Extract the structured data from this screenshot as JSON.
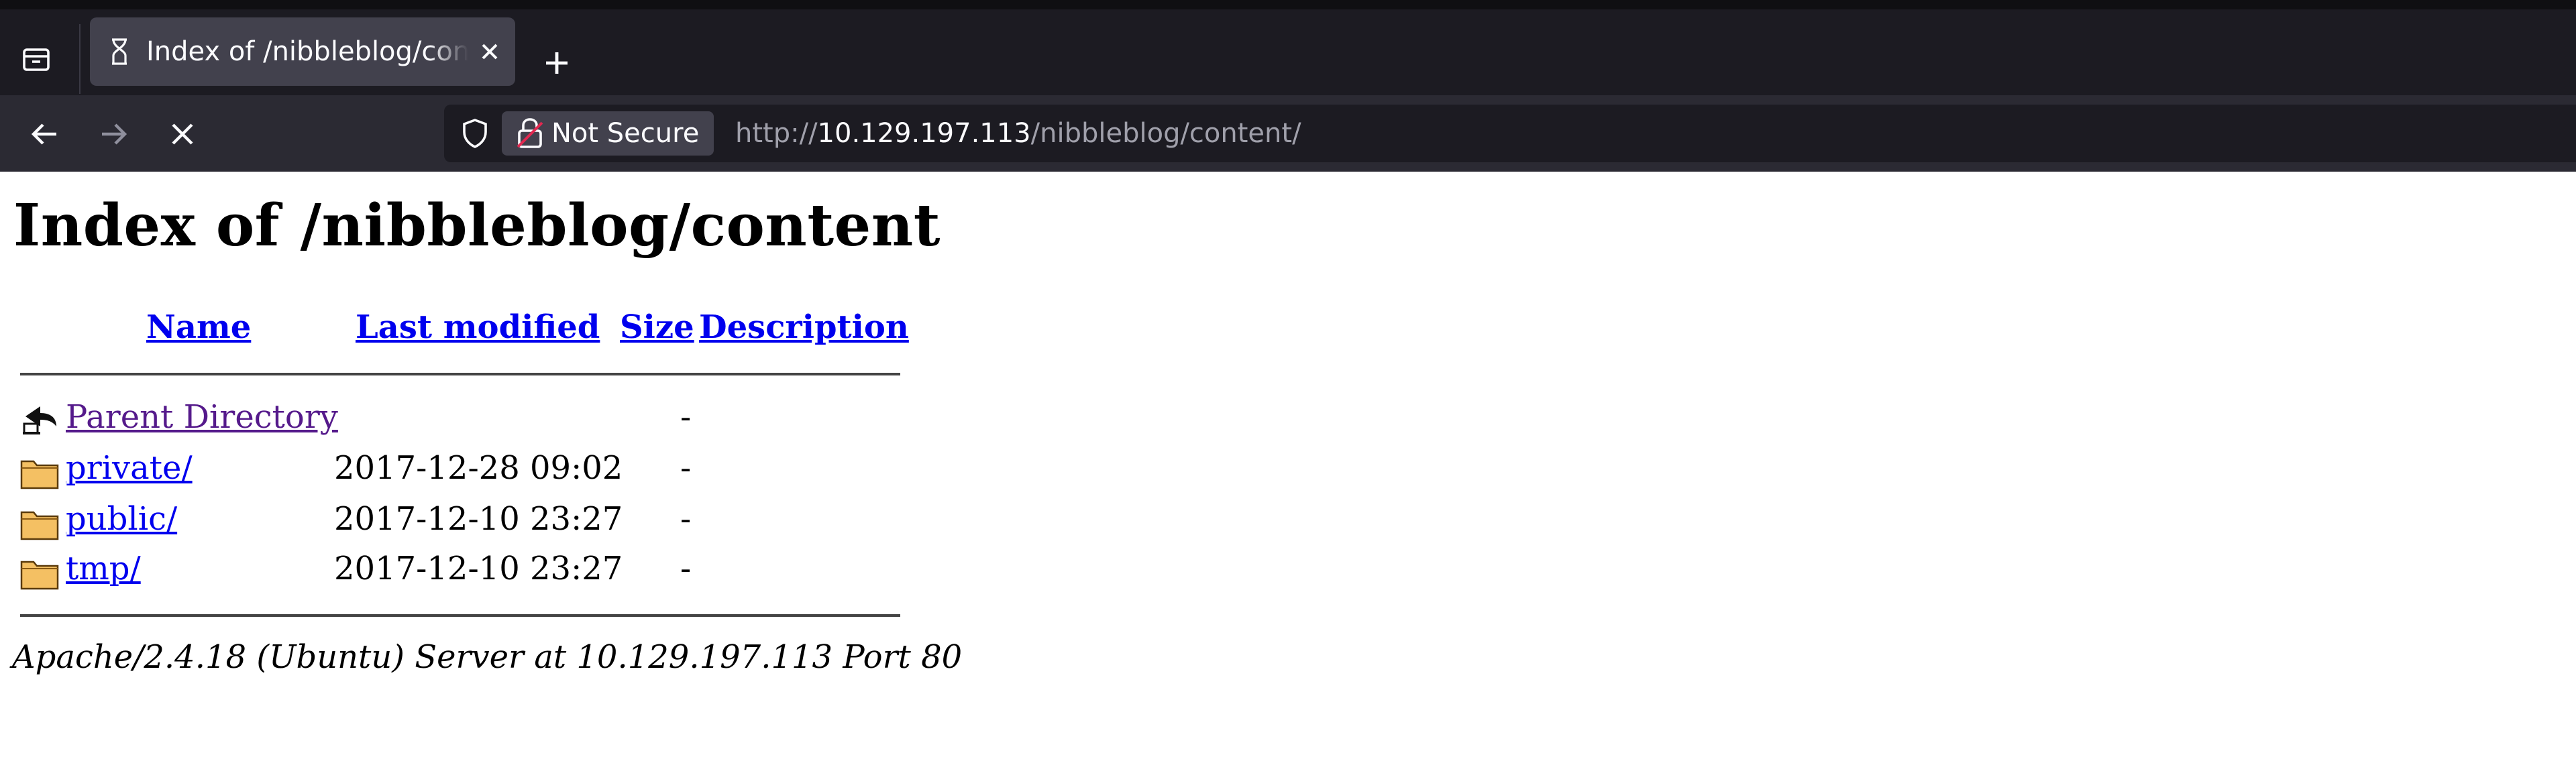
{
  "browser": {
    "tab": {
      "title": "Index of /nibbleblog/content/"
    },
    "url": {
      "scheme": "http://",
      "host": "10.129.197.113",
      "path": "/nibbleblog/content/"
    },
    "security_label": "Not Secure"
  },
  "page": {
    "heading": "Index of /nibbleblog/content",
    "columns": {
      "name": "Name",
      "last_modified": "Last modified",
      "size": "Size",
      "description": "Description"
    },
    "rows": [
      {
        "name": "Parent Directory",
        "modified": "",
        "size": "-",
        "icon": "back-arrow-icon"
      },
      {
        "name": "private/",
        "modified": "2017-12-28 09:02",
        "size": "-",
        "icon": "folder-icon"
      },
      {
        "name": "public/",
        "modified": "2017-12-10 23:27",
        "size": "-",
        "icon": "folder-icon"
      },
      {
        "name": "tmp/",
        "modified": "2017-12-10 23:27",
        "size": "-",
        "icon": "folder-icon"
      }
    ],
    "footer": "Apache/2.4.18 (Ubuntu) Server at 10.129.197.113 Port 80"
  }
}
